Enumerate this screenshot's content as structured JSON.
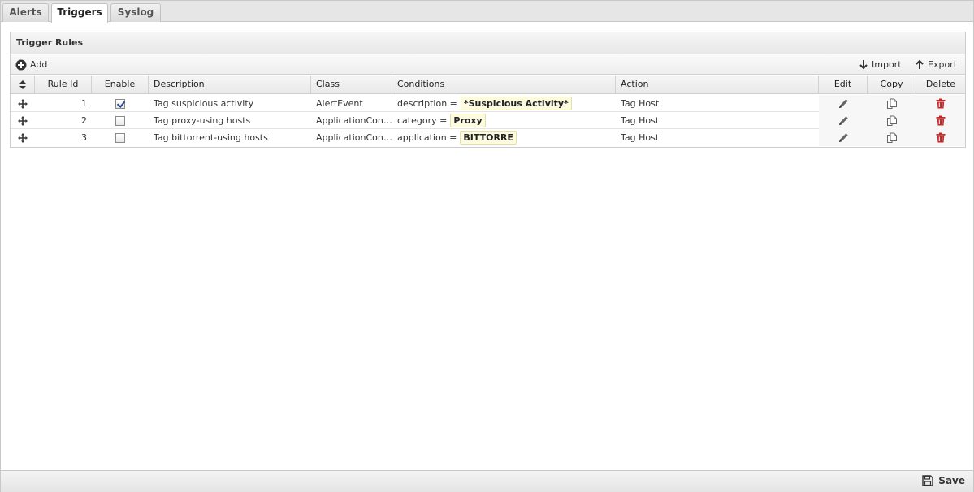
{
  "tabs": [
    {
      "label": "Alerts",
      "active": false
    },
    {
      "label": "Triggers",
      "active": true
    },
    {
      "label": "Syslog",
      "active": false
    }
  ],
  "panel": {
    "title": "Trigger Rules"
  },
  "toolbar": {
    "add_label": "Add",
    "import_label": "Import",
    "export_label": "Export"
  },
  "columns": {
    "rule_id": "Rule Id",
    "enable": "Enable",
    "description": "Description",
    "class": "Class",
    "conditions": "Conditions",
    "action": "Action",
    "edit": "Edit",
    "copy": "Copy",
    "delete": "Delete"
  },
  "rows": [
    {
      "rule_id": "1",
      "enabled": true,
      "description": "Tag suspicious activity",
      "class": "AlertEvent",
      "cond_field": "description =",
      "cond_value": "*Suspicious Activity*",
      "action": "Tag Host"
    },
    {
      "rule_id": "2",
      "enabled": false,
      "description": "Tag proxy-using hosts",
      "class": "ApplicationControlLogEvent",
      "cond_field": "category =",
      "cond_value": "Proxy",
      "action": "Tag Host"
    },
    {
      "rule_id": "3",
      "enabled": false,
      "description": "Tag bittorrent-using hosts",
      "class": "ApplicationControlLogEvent",
      "cond_field": "application =",
      "cond_value": "BITTORRE",
      "action": "Tag Host"
    }
  ],
  "footer": {
    "save_label": "Save"
  },
  "colors": {
    "delete_icon": "#c62828",
    "condition_bg": "#fcfbe0"
  }
}
